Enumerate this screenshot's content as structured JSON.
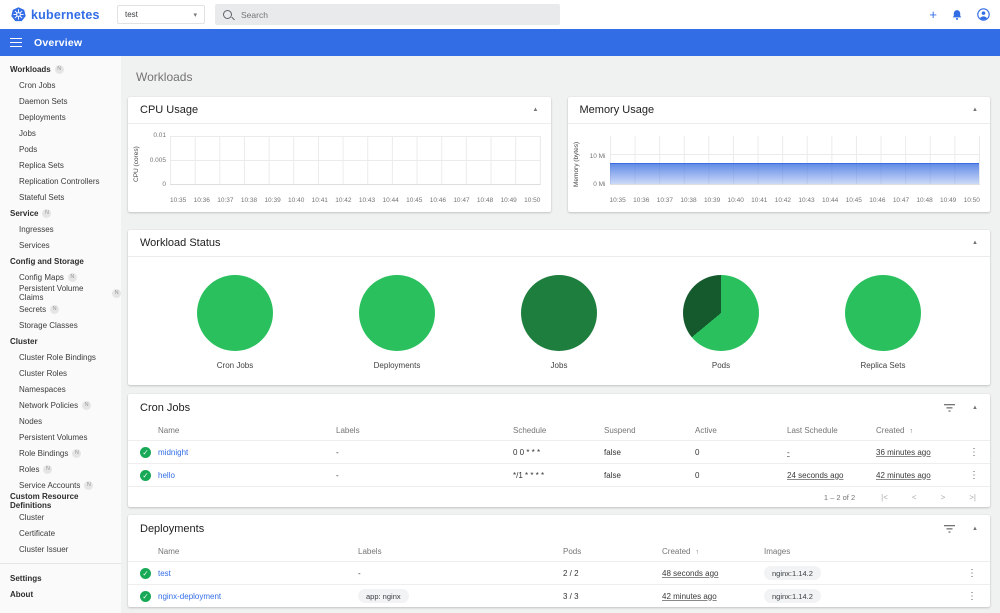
{
  "header": {
    "logo_text": "kubernetes",
    "namespace": {
      "value": "test"
    },
    "search": {
      "placeholder": "Search"
    }
  },
  "appbar": {
    "title": "Overview"
  },
  "icons": {
    "dropdown_caret": "▾",
    "collapse_caret": "▲",
    "sort_asc": "↑",
    "row_menu": "⋮",
    "check": "✓",
    "add": "+",
    "page_first": "|<",
    "page_prev": "<",
    "page_next": ">",
    "page_last": ">|"
  },
  "colors": {
    "brand_blue": "#326de6",
    "chart_area_line": "#3b6de0",
    "pie_green_bright": "#2ac05e",
    "pie_green_dark": "#1e7e3e",
    "pie_green_slice_dark": "#155a2d",
    "status_check_green": "#18a957"
  },
  "sidebar": {
    "groups": [
      {
        "label": "Workloads",
        "badge": "N",
        "items": [
          {
            "label": "Cron Jobs"
          },
          {
            "label": "Daemon Sets"
          },
          {
            "label": "Deployments"
          },
          {
            "label": "Jobs"
          },
          {
            "label": "Pods"
          },
          {
            "label": "Replica Sets"
          },
          {
            "label": "Replication Controllers"
          },
          {
            "label": "Stateful Sets"
          }
        ]
      },
      {
        "label": "Service",
        "badge": "N",
        "items": [
          {
            "label": "Ingresses"
          },
          {
            "label": "Services"
          }
        ]
      },
      {
        "label": "Config and Storage",
        "items": [
          {
            "label": "Config Maps",
            "badge": "N"
          },
          {
            "label": "Persistent Volume Claims",
            "badge": "N"
          },
          {
            "label": "Secrets",
            "badge": "N"
          },
          {
            "label": "Storage Classes"
          }
        ]
      },
      {
        "label": "Cluster",
        "items": [
          {
            "label": "Cluster Role Bindings"
          },
          {
            "label": "Cluster Roles"
          },
          {
            "label": "Namespaces"
          },
          {
            "label": "Network Policies",
            "badge": "N"
          },
          {
            "label": "Nodes"
          },
          {
            "label": "Persistent Volumes"
          },
          {
            "label": "Role Bindings",
            "badge": "N"
          },
          {
            "label": "Roles",
            "badge": "N"
          },
          {
            "label": "Service Accounts",
            "badge": "N"
          }
        ]
      },
      {
        "label": "Custom Resource Definitions",
        "items": [
          {
            "label": "Cluster"
          },
          {
            "label": "Certificate"
          },
          {
            "label": "Cluster Issuer"
          }
        ]
      }
    ],
    "footer": [
      {
        "label": "Settings"
      },
      {
        "label": "About"
      }
    ]
  },
  "page": {
    "title": "Workloads"
  },
  "chart_data": [
    {
      "type": "line",
      "title": "CPU Usage",
      "ylabel": "CPU (cores)",
      "y_ticks": [
        "0.01",
        "0.005",
        "0"
      ],
      "ylim": [
        0,
        0.01
      ],
      "x": [
        "10:35",
        "10:36",
        "10:37",
        "10:38",
        "10:39",
        "10:40",
        "10:41",
        "10:42",
        "10:43",
        "10:44",
        "10:45",
        "10:46",
        "10:47",
        "10:48",
        "10:49",
        "10:50"
      ],
      "series": [],
      "grid": "on",
      "note": "no data plotted"
    },
    {
      "type": "area",
      "title": "Memory Usage",
      "ylabel": "Memory (bytes)",
      "y_ticks": [
        "10 Mi",
        "0 Mi"
      ],
      "x": [
        "10:35",
        "10:36",
        "10:37",
        "10:38",
        "10:39",
        "10:40",
        "10:41",
        "10:42",
        "10:43",
        "10:44",
        "10:45",
        "10:46",
        "10:47",
        "10:48",
        "10:49",
        "10:50"
      ],
      "series": [
        {
          "name": "memory",
          "constant_value": "≈7.5 Mi"
        }
      ],
      "fill_percent": 44,
      "grid": "on"
    },
    {
      "type": "pie",
      "title": "Workload Status",
      "pies": [
        {
          "label": "Cron Jobs",
          "slices": [
            {
              "color": "#2ac05e",
              "value": 100
            }
          ]
        },
        {
          "label": "Deployments",
          "slices": [
            {
              "color": "#2ac05e",
              "value": 100
            }
          ]
        },
        {
          "label": "Jobs",
          "slices": [
            {
              "color": "#1e7e3e",
              "value": 100
            }
          ]
        },
        {
          "label": "Pods",
          "slices": [
            {
              "color": "#2ac05e",
              "value": 64
            },
            {
              "color": "#155a2d",
              "value": 36
            }
          ]
        },
        {
          "label": "Replica Sets",
          "slices": [
            {
              "color": "#2ac05e",
              "value": 100
            }
          ]
        }
      ]
    }
  ],
  "cron_jobs": {
    "title": "Cron Jobs",
    "columns": [
      "Name",
      "Labels",
      "Schedule",
      "Suspend",
      "Active",
      "Last Schedule",
      "Created"
    ],
    "rows": [
      {
        "name": "midnight",
        "labels": "-",
        "schedule": "0 0 * * *",
        "suspend": "false",
        "active": "0",
        "last_schedule": "-",
        "created": "36 minutes ago"
      },
      {
        "name": "hello",
        "labels": "-",
        "schedule": "*/1 * * * *",
        "suspend": "false",
        "active": "0",
        "last_schedule": "24 seconds ago",
        "created": "42 minutes ago"
      }
    ],
    "pagination": {
      "range": "1 – 2 of 2"
    }
  },
  "deployments": {
    "title": "Deployments",
    "columns": [
      "Name",
      "Labels",
      "Pods",
      "Created",
      "Images"
    ],
    "rows": [
      {
        "name": "test",
        "labels": "-",
        "labels_is_chip": false,
        "pods": "2 / 2",
        "created": "48 seconds ago",
        "images": "nginx:1.14.2"
      },
      {
        "name": "nginx-deployment",
        "labels": "app: nginx",
        "labels_is_chip": true,
        "pods": "3 / 3",
        "created": "42 minutes ago",
        "images": "nginx:1.14.2"
      }
    ]
  }
}
